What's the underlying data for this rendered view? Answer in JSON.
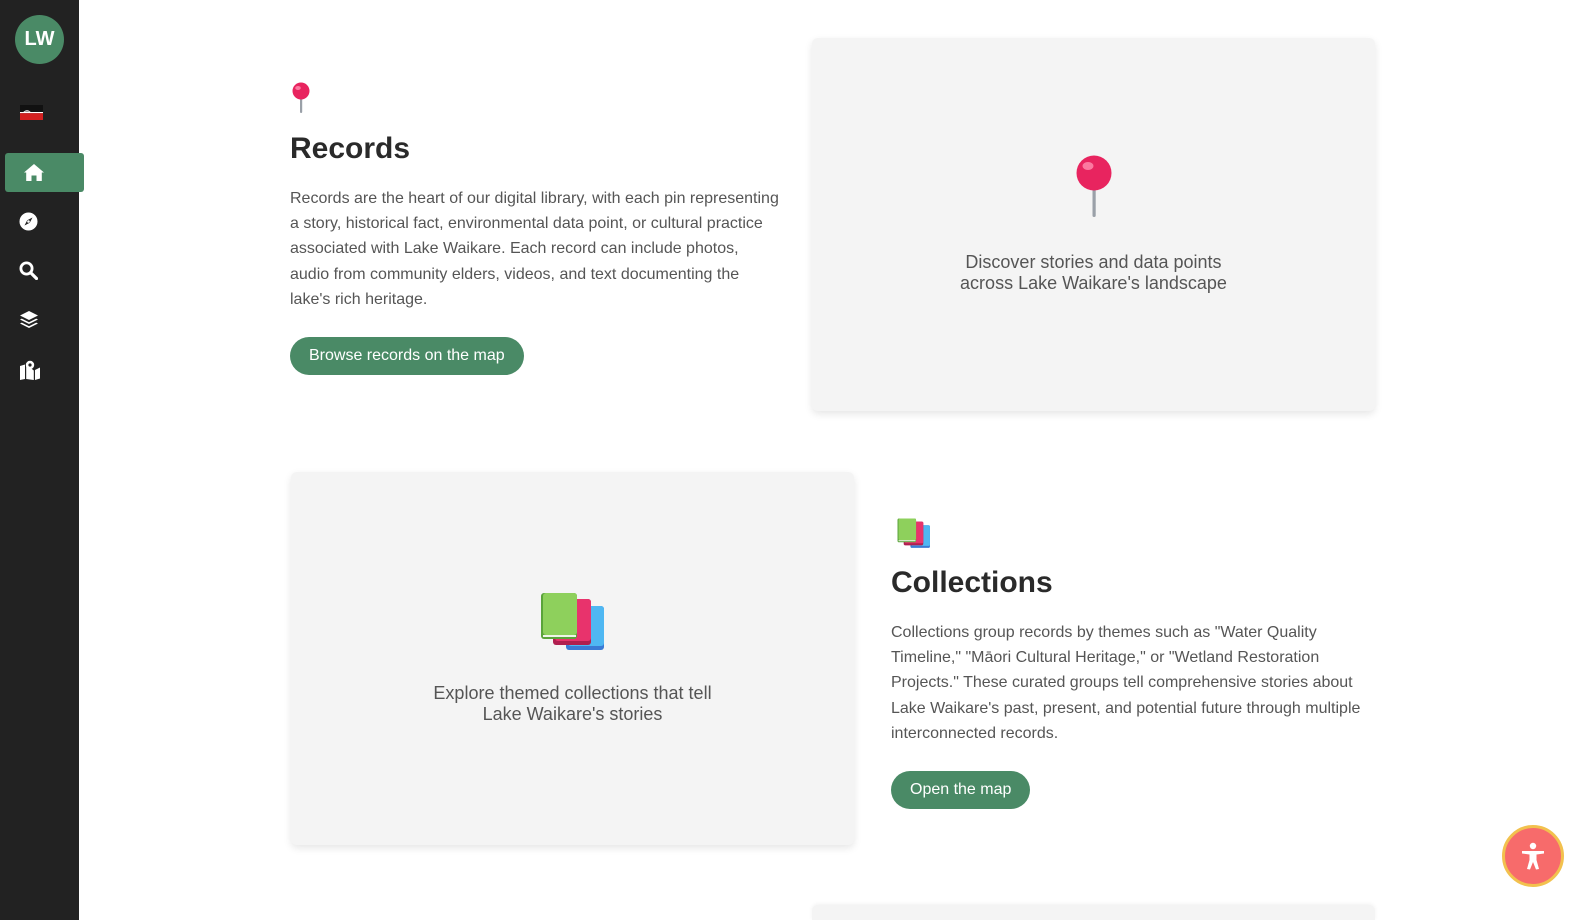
{
  "sidebar": {
    "avatar_initials": "LW",
    "items": [
      {
        "icon": "home-icon",
        "active": true
      },
      {
        "icon": "compass-icon",
        "active": false
      },
      {
        "icon": "search-icon",
        "active": false
      },
      {
        "icon": "layers-icon",
        "active": false
      },
      {
        "icon": "map-marker-icon",
        "active": false
      }
    ]
  },
  "records": {
    "emoji": "📍",
    "title": "Records",
    "description": "Records are the heart of our digital library, with each pin representing a story, historical fact, environmental data point, or cultural practice associated with Lake Waikare. Each record can include photos, audio from community elders, videos, and text documenting the lake's rich heritage.",
    "button_label": "Browse records on the map",
    "card_emoji": "📍",
    "card_caption": "Discover stories and data points across Lake Waikare's landscape"
  },
  "collections": {
    "emoji": "📚",
    "title": "Collections",
    "description": "Collections group records by themes such as \"Water Quality Timeline,\" \"Māori Cultural Heritage,\" or \"Wetland Restoration Projects.\" These curated groups tell comprehensive stories about Lake Waikare's past, present, and potential future through multiple interconnected records.",
    "button_label": "Open the map",
    "card_emoji": "📚",
    "card_caption": "Explore themed collections that tell Lake Waikare's stories"
  },
  "colors": {
    "sidebar_bg": "#222222",
    "accent_green": "#4a8a66",
    "card_bg": "#f4f4f4",
    "accessibility_bg": "#f76b6b",
    "accessibility_border": "#f2c14e"
  }
}
